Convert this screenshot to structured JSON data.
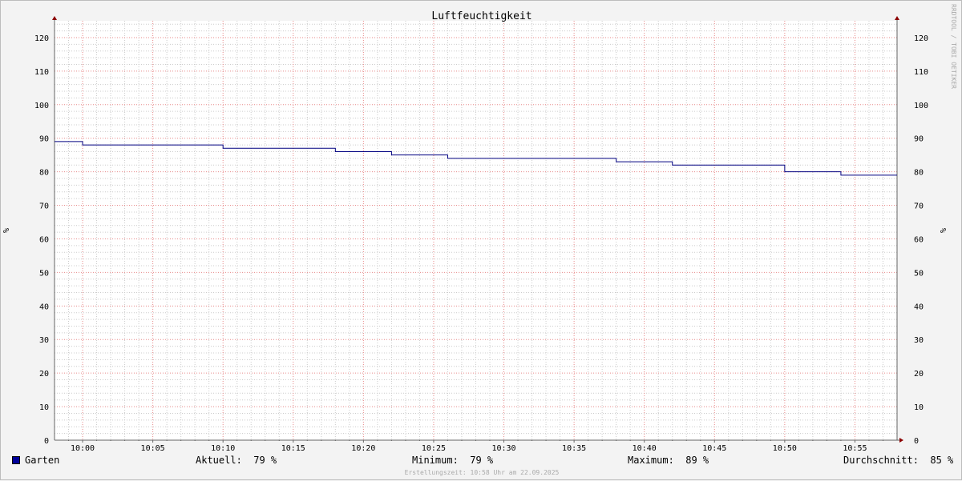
{
  "chart_data": {
    "type": "line",
    "title": "Luftfeuchtigkeit",
    "ylabel_left": "%",
    "ylabel_right": "%",
    "ylim": [
      0,
      125
    ],
    "yticks": [
      0,
      10,
      20,
      30,
      40,
      50,
      60,
      70,
      80,
      90,
      100,
      110,
      120
    ],
    "xlim": [
      "09:58",
      "10:58"
    ],
    "xticks": [
      "10:00",
      "10:05",
      "10:10",
      "10:15",
      "10:20",
      "10:25",
      "10:30",
      "10:35",
      "10:40",
      "10:45",
      "10:50",
      "10:55"
    ],
    "grid": true,
    "legend_placement": "bottom-left",
    "series": [
      {
        "name": "Garten",
        "color": "#000080",
        "step": true,
        "x": [
          "09:58",
          "10:00",
          "10:10",
          "10:18",
          "10:20",
          "10:22",
          "10:26",
          "10:38",
          "10:42",
          "10:50",
          "10:52",
          "10:54",
          "10:58"
        ],
        "values": [
          89,
          88,
          87,
          86,
          86,
          85,
          84,
          83,
          82,
          80,
          80,
          79,
          79
        ]
      }
    ]
  },
  "legend": {
    "series_name": "Garten",
    "swatch_color": "#000099",
    "aktuell": "Aktuell:  79 %",
    "minimum": "Minimum:  79 %",
    "maximum": "Maximum:  89 %",
    "durchschnitt": "Durchschnitt:  85 %"
  },
  "footer": "Erstellungszeit: 10:58 Uhr am 22.09.2025",
  "watermark": "RRDTOOL / TOBI OETIKER",
  "colors": {
    "grid_major": "#e88a8a",
    "grid_minor": "#cccccc",
    "axis": "#666666",
    "arrow": "#8b0000"
  }
}
